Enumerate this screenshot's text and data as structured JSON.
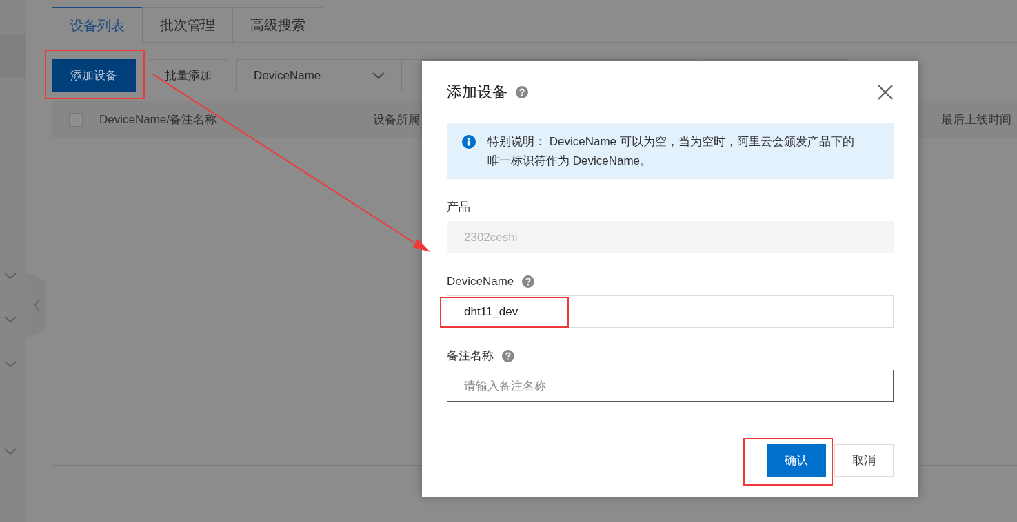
{
  "tabs": [
    {
      "label": "设备列表",
      "selected": true
    },
    {
      "label": "批次管理",
      "selected": false
    },
    {
      "label": "高级搜索",
      "selected": false
    }
  ],
  "toolbar": {
    "add_button": "添加设备",
    "batch_button": "批量添加",
    "filter_select": "DeviceName"
  },
  "table": {
    "select_all_checked": false,
    "columns": [
      "DeviceName/备注名称",
      "设备所属",
      "最后上线时间"
    ]
  },
  "dialog": {
    "title": "添加设备",
    "notice": "特别说明： DeviceName 可以为空，当为空时，阿里云会颁发产品下的唯一标识符作为 DeviceName。",
    "fields": [
      {
        "label": "产品",
        "help": false,
        "value": "2302ceshi",
        "disabled": true
      },
      {
        "label": "DeviceName",
        "help": true,
        "value": "dht11_dev",
        "disabled": false
      },
      {
        "label": "备注名称",
        "help": true,
        "placeholder": "请输入备注名称",
        "disabled": false
      }
    ],
    "buttons": [
      {
        "label": "确认",
        "kind": "primary"
      },
      {
        "label": "取消",
        "kind": "secondary"
      }
    ]
  }
}
